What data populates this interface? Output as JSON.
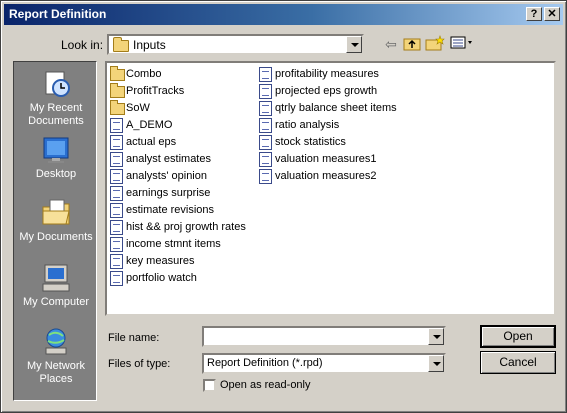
{
  "window": {
    "title": "Report Definition",
    "help_label": "?",
    "close_label": "✕"
  },
  "lookin": {
    "label": "Look in:",
    "value": "Inputs"
  },
  "toolbar": {
    "back_icon": "back-arrow-icon",
    "up_icon": "up-folder-icon",
    "new_folder_icon": "new-folder-icon",
    "views_icon": "views-menu-icon"
  },
  "places": [
    {
      "label": "My Recent Documents",
      "icon": "recent-documents-icon"
    },
    {
      "label": "Desktop",
      "icon": "desktop-icon"
    },
    {
      "label": "My Documents",
      "icon": "my-documents-icon"
    },
    {
      "label": "My Computer",
      "icon": "my-computer-icon"
    },
    {
      "label": "My Network Places",
      "icon": "network-places-icon"
    }
  ],
  "files": {
    "col1": [
      {
        "name": "Combo",
        "type": "folder"
      },
      {
        "name": "ProfitTracks",
        "type": "folder"
      },
      {
        "name": "SoW",
        "type": "folder"
      },
      {
        "name": "A_DEMO",
        "type": "file"
      },
      {
        "name": "actual eps",
        "type": "file"
      },
      {
        "name": "analyst estimates",
        "type": "file"
      },
      {
        "name": "analysts' opinion",
        "type": "file"
      },
      {
        "name": "earnings surprise",
        "type": "file"
      },
      {
        "name": "estimate revisions",
        "type": "file"
      },
      {
        "name": "hist && proj growth rates",
        "type": "file"
      },
      {
        "name": "income stmnt items",
        "type": "file"
      },
      {
        "name": "key measures",
        "type": "file"
      },
      {
        "name": "portfolio watch",
        "type": "file"
      }
    ],
    "col2": [
      {
        "name": "profitability measures",
        "type": "file"
      },
      {
        "name": "projected eps growth",
        "type": "file"
      },
      {
        "name": "qtrly balance sheet items",
        "type": "file"
      },
      {
        "name": "ratio analysis",
        "type": "file"
      },
      {
        "name": "stock statistics",
        "type": "file"
      },
      {
        "name": "valuation measures1",
        "type": "file"
      },
      {
        "name": "valuation measures2",
        "type": "file"
      }
    ]
  },
  "filename": {
    "label": "File name:",
    "value": ""
  },
  "filetype": {
    "label": "Files of type:",
    "value": "Report Definition (*.rpd)"
  },
  "readonly": {
    "label": "Open as read-only",
    "checked": false
  },
  "buttons": {
    "open": "Open",
    "cancel": "Cancel"
  }
}
